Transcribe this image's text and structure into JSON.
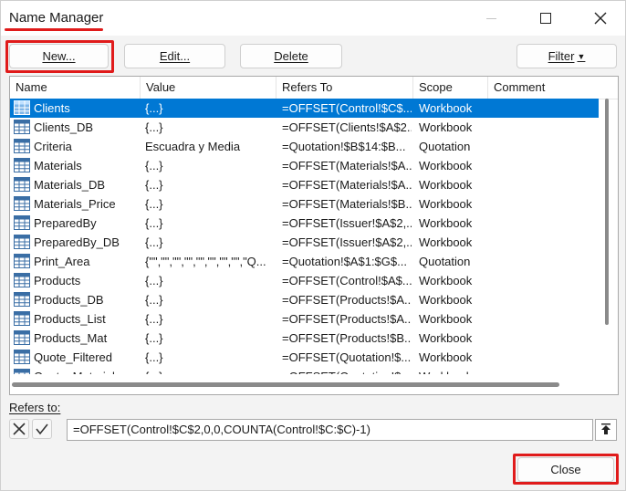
{
  "window": {
    "title": "Name Manager"
  },
  "toolbar": {
    "new_label": "New...",
    "edit_label": "Edit...",
    "delete_label": "Delete",
    "filter_label": "Filter"
  },
  "table": {
    "columns": [
      "Name",
      "Value",
      "Refers To",
      "Scope",
      "Comment"
    ],
    "rows": [
      {
        "name": "Clients",
        "value": "{...}",
        "refers_to": "=OFFSET(Control!$C$...",
        "scope": "Workbook",
        "comment": "",
        "selected": true
      },
      {
        "name": "Clients_DB",
        "value": "{...}",
        "refers_to": "=OFFSET(Clients!$A$2...",
        "scope": "Workbook",
        "comment": ""
      },
      {
        "name": "Criteria",
        "value": "Escuadra y Media",
        "refers_to": "=Quotation!$B$14:$B...",
        "scope": "Quotation",
        "comment": ""
      },
      {
        "name": "Materials",
        "value": "{...}",
        "refers_to": "=OFFSET(Materials!$A...",
        "scope": "Workbook",
        "comment": ""
      },
      {
        "name": "Materials_DB",
        "value": "{...}",
        "refers_to": "=OFFSET(Materials!$A...",
        "scope": "Workbook",
        "comment": ""
      },
      {
        "name": "Materials_Price",
        "value": "{...}",
        "refers_to": "=OFFSET(Materials!$B...",
        "scope": "Workbook",
        "comment": ""
      },
      {
        "name": "PreparedBy",
        "value": "{...}",
        "refers_to": "=OFFSET(Issuer!$A$2,...",
        "scope": "Workbook",
        "comment": ""
      },
      {
        "name": "PreparedBy_DB",
        "value": "{...}",
        "refers_to": "=OFFSET(Issuer!$A$2,...",
        "scope": "Workbook",
        "comment": ""
      },
      {
        "name": "Print_Area",
        "value": "{\"\",\"\",\"\",\"\",\"\",\"\",\"\",\"\",\"Q...",
        "refers_to": "=Quotation!$A$1:$G$...",
        "scope": "Quotation",
        "comment": ""
      },
      {
        "name": "Products",
        "value": "{...}",
        "refers_to": "=OFFSET(Control!$A$...",
        "scope": "Workbook",
        "comment": ""
      },
      {
        "name": "Products_DB",
        "value": "{...}",
        "refers_to": "=OFFSET(Products!$A...",
        "scope": "Workbook",
        "comment": ""
      },
      {
        "name": "Products_List",
        "value": "{...}",
        "refers_to": "=OFFSET(Products!$A...",
        "scope": "Workbook",
        "comment": ""
      },
      {
        "name": "Products_Mat",
        "value": "{...}",
        "refers_to": "=OFFSET(Products!$B...",
        "scope": "Workbook",
        "comment": ""
      },
      {
        "name": "Quote_Filtered",
        "value": "{...}",
        "refers_to": "=OFFSET(Quotation!$...",
        "scope": "Workbook",
        "comment": ""
      },
      {
        "name": "Quote_Material",
        "value": "{...}",
        "refers_to": "=OFFSET(Quotation!$...",
        "scope": "Workbook",
        "comment": ""
      }
    ]
  },
  "refers_to": {
    "label": "Refers to:",
    "value": "=OFFSET(Control!$C$2,0,0,COUNTA(Control!$C:$C)-1)"
  },
  "footer": {
    "close_label": "Close"
  },
  "colors": {
    "selection": "#0078d4",
    "highlight": "#e01b1b"
  },
  "icons": {
    "row_icon": "range-table-icon",
    "cancel": "cancel-x-icon",
    "confirm": "checkmark-icon",
    "collapse": "collapse-dialog-icon"
  }
}
